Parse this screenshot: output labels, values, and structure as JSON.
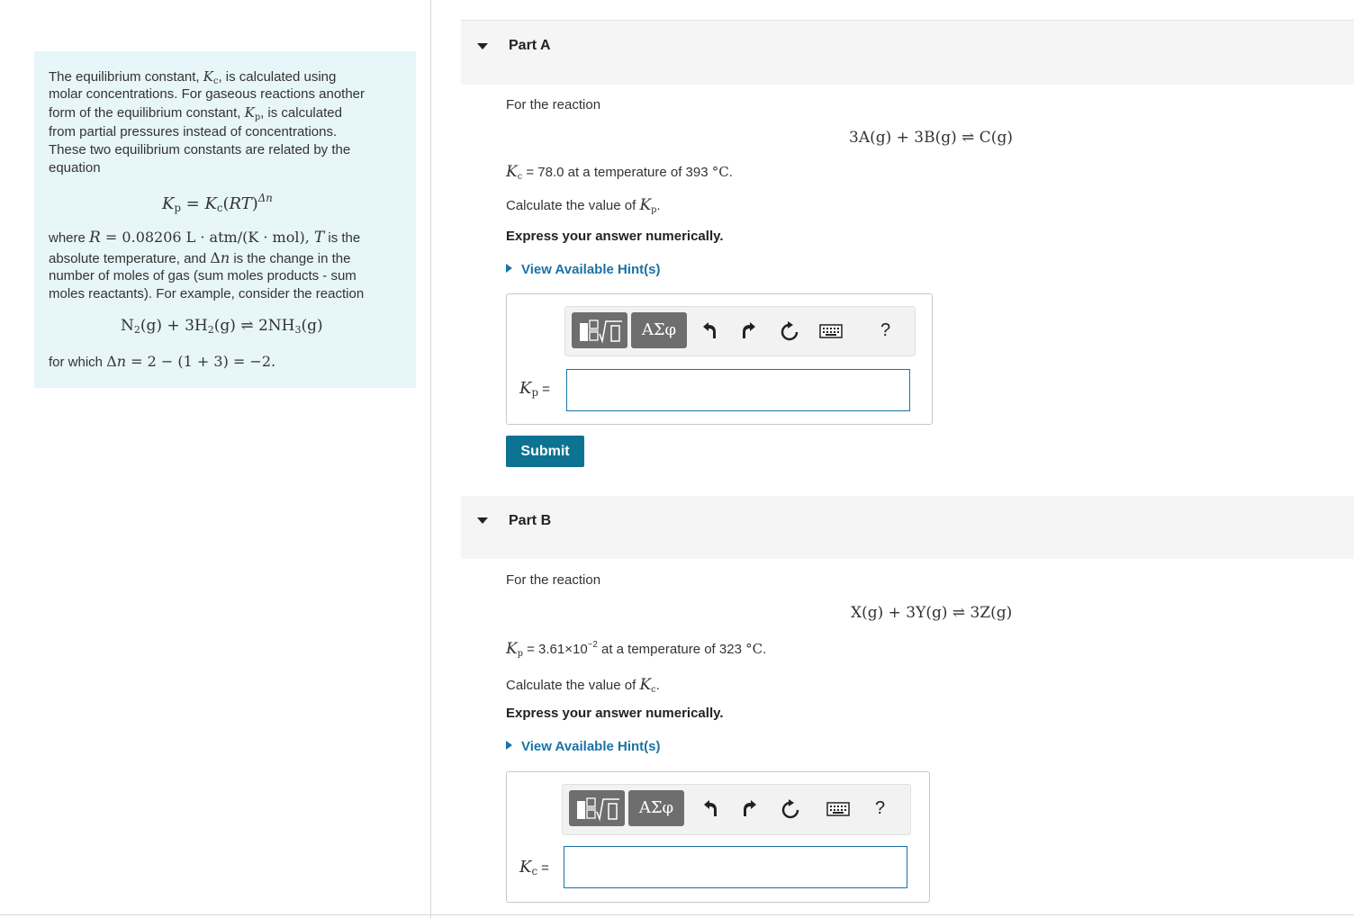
{
  "intro": {
    "line1_pre": "The equilibrium constant, ",
    "line1_post": ", is calculated using",
    "line2": "molar concentrations. For gaseous reactions another",
    "line3_pre": "form of the equilibrium constant, ",
    "line3_post": ", is calculated",
    "line4": "from partial pressures instead of concentrations.",
    "line5": "These two equilibrium constants are related by the",
    "line6": "equation",
    "where": "where ",
    "r_value": "0.08206 L · atm/(K · mol)",
    "is_the": " is the",
    "absolute_pre": "absolute temperature, and ",
    "absolute_post": " is the change in the",
    "line_moles": "number of moles of gas (sum moles products - sum",
    "line_reactants": "moles reactants). For example, consider the reaction",
    "for_which": "for which ",
    "delta_expr": " = 2 − (1 + 3) = −2."
  },
  "partA": {
    "title": "Part A",
    "for_reaction": "For the reaction",
    "kc_value_text": " = 78.0 at a temperature of 393 ",
    "unit": "°C",
    "calc_text": "Calculate the value of ",
    "express": "Express your answer numerically.",
    "hint": "View Available Hint(s)",
    "answer_label_eq": " =",
    "submit": "Submit"
  },
  "partB": {
    "title": "Part B",
    "for_reaction": "For the reaction",
    "kp_value_text": " = 3.61×10",
    "kp_exp": "−2",
    "kp_rest": " at a temperature of 323 ",
    "unit": "°C",
    "calc_text": "Calculate the value of ",
    "express": "Express your answer numerically.",
    "hint": "View Available Hint(s)",
    "answer_label_eq": " ="
  },
  "toolbar": {
    "greek": "ΑΣφ",
    "help": "?"
  },
  "icons": [
    "triangle-down-icon",
    "triangle-right-icon",
    "templates-icon",
    "greek-icon",
    "undo-icon",
    "redo-icon",
    "reset-icon",
    "keyboard-icon",
    "help-icon"
  ],
  "colors": {
    "intro_bg": "#e7f6f8",
    "link": "#1a73a5",
    "submit_bg": "#0c7392",
    "toolbar_btn": "#6e6e6e"
  }
}
